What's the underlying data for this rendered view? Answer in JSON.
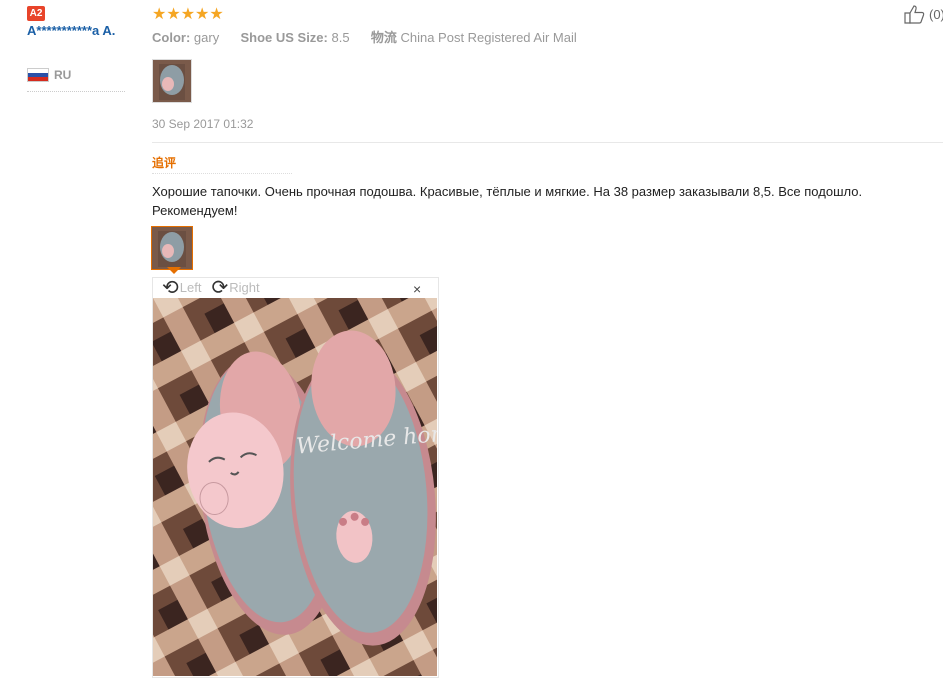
{
  "user": {
    "level_badge": "A2",
    "name": "A***********a A.",
    "country_code": "RU"
  },
  "review": {
    "stars": "★★★★★",
    "color_label": "Color:",
    "color_value": "gary",
    "size_label": "Shoe US Size:",
    "size_value": "8.5",
    "logistics_label": "物流",
    "logistics_value": "China Post Registered Air Mail",
    "like_count": "(0)",
    "date": "30 Sep 2017 01:32",
    "additional_label": "追评",
    "additional_text": "Хорошие тапочки. Очень прочная подошва. Красивые, тёплые и мягкие. На 38 размер заказывали 8,5. Все подошло. Рекомендуем!"
  },
  "viewer": {
    "rotate_left_label": "Left",
    "rotate_right_label": "Right",
    "close_glyph": "×",
    "image_text": "Welcome home!"
  },
  "colors": {
    "accent_orange": "#e56f00",
    "star": "#f5a623",
    "link_blue": "#1a5fa6",
    "badge_red": "#e8442a"
  }
}
